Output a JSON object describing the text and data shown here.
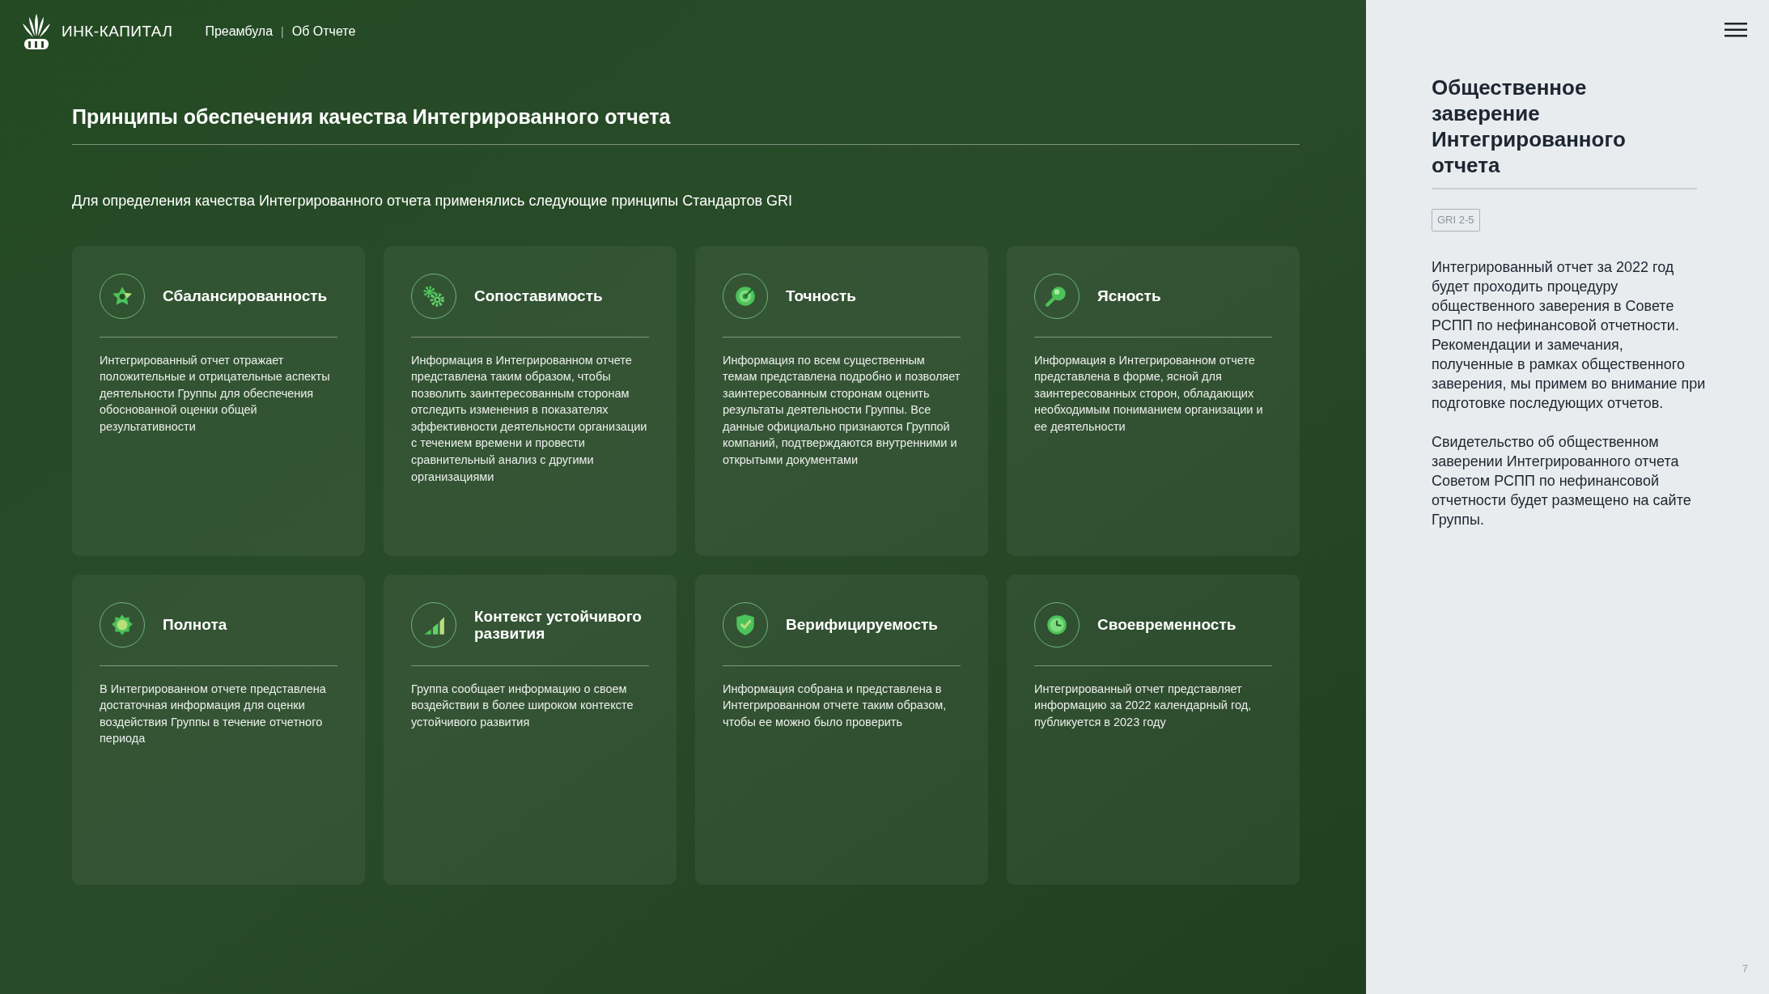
{
  "header": {
    "logo": "ИНК-КАПИТАЛ",
    "breadcrumbs": [
      "Преамбула",
      "Об Отчете"
    ],
    "separator": "|"
  },
  "main": {
    "title": "Принципы обеспечения качества Интегрированного отчета",
    "intro": "Для определения качества Интегрированного отчета применялись следующие принципы Стандартов GRI",
    "cards": [
      {
        "title": "Сбалансированность",
        "text": "Интегрированный отчет отражает положительные и отрицательные аспекты деятельности Группы для обеспечения обоснованной оценки общей результативности"
      },
      {
        "title": "Сопоставимость",
        "text": "Информация в Интегрированном отчете представлена таким образом, чтобы позволить заинтересованным сторонам отследить изменения в показателях эффективности деятельности организации с течением времени и провести сравнительный анализ с другими организациями"
      },
      {
        "title": "Точность",
        "text": "Информация по всем существенным темам представлена подробно и позволяет заинтересованным сторонам оценить результаты деятельности Группы. Все данные официально признаются Группой компаний, подтверждаются внутренними и открытыми документами"
      },
      {
        "title": "Ясность",
        "text": "Информация в Интегрированном отчете представлена в форме, ясной для заинтересованных сторон, обладающих необходимым пониманием организации и ее деятельности"
      },
      {
        "title": "Полнота",
        "text": "В Интегрированном отчете представлена достаточная информация для оценки воздействия Группы в течение отчетного периода"
      },
      {
        "title": "Контекст устойчивого развития",
        "text": "Группа сообщает информацию о своем воздействии в более широком контексте устойчивого развития"
      },
      {
        "title": "Верифицируемость",
        "text": "Информация собрана и представлена в Интегрированном отчете таким образом, чтобы ее можно было проверить"
      },
      {
        "title": "Своевременность",
        "text": "Интегрированный отчет представляет информацию за 2022 календарный год, публикуется в 2023 году"
      }
    ]
  },
  "sidebar": {
    "title": "Общественное заверение Интегрированного отчета",
    "tag": "GRI 2-5",
    "paragraphs": [
      "Интегрированный отчет за 2022 год будет проходить процедуру общественного заверения в Совете РСПП по нефинансовой отчетности. Рекомендации и замечания, полученные в рамках общественного заверения, мы примем во внимание при подготовке последующих отчетов.",
      "Свидетельство об общественном заверении Интегрированного отчета Советом РСПП по нефинансовой отчетности будет размещено на сайте Группы."
    ],
    "page_number": "7"
  }
}
